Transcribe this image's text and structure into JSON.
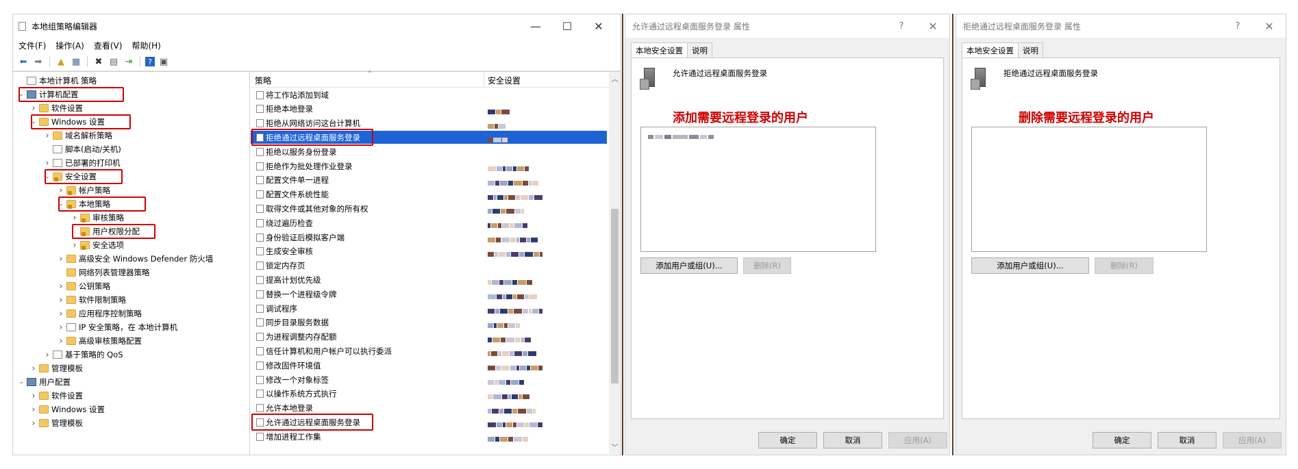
{
  "gpedit": {
    "title": "本地组策略编辑器",
    "menu": [
      "文件(F)",
      "操作(A)",
      "查看(V)",
      "帮助(H)"
    ],
    "tree": [
      {
        "label": "本地计算机 策略",
        "level": 0,
        "arrow": "",
        "icon": "doc"
      },
      {
        "label": "计算机配置",
        "level": 0,
        "arrow": "v",
        "icon": "pc"
      },
      {
        "label": "软件设置",
        "level": 1,
        "arrow": ">",
        "icon": "folder"
      },
      {
        "label": "Windows 设置",
        "level": 1,
        "arrow": "v",
        "icon": "folder"
      },
      {
        "label": "域名解析策略",
        "level": 2,
        "arrow": ">",
        "icon": "folder"
      },
      {
        "label": "脚本(启动/关机)",
        "level": 2,
        "arrow": "",
        "icon": "doc"
      },
      {
        "label": "已部署的打印机",
        "level": 2,
        "arrow": ">",
        "icon": "doc"
      },
      {
        "label": "安全设置",
        "level": 2,
        "arrow": "v",
        "icon": "folder-lock"
      },
      {
        "label": "帐户策略",
        "level": 3,
        "arrow": ">",
        "icon": "folder-lock"
      },
      {
        "label": "本地策略",
        "level": 3,
        "arrow": "v",
        "icon": "folder-lock"
      },
      {
        "label": "审核策略",
        "level": 4,
        "arrow": ">",
        "icon": "folder-lock"
      },
      {
        "label": "用户权限分配",
        "level": 4,
        "arrow": "",
        "icon": "folder-lock"
      },
      {
        "label": "安全选项",
        "level": 4,
        "arrow": ">",
        "icon": "folder-lock"
      },
      {
        "label": "高级安全 Windows Defender 防火墙",
        "level": 3,
        "arrow": ">",
        "icon": "folder"
      },
      {
        "label": "网络列表管理器策略",
        "level": 3,
        "arrow": "",
        "icon": "folder"
      },
      {
        "label": "公钥策略",
        "level": 3,
        "arrow": ">",
        "icon": "folder"
      },
      {
        "label": "软件限制策略",
        "level": 3,
        "arrow": ">",
        "icon": "folder"
      },
      {
        "label": "应用程序控制策略",
        "level": 3,
        "arrow": ">",
        "icon": "folder"
      },
      {
        "label": "IP 安全策略，在 本地计算机",
        "level": 3,
        "arrow": ">",
        "icon": "doc"
      },
      {
        "label": "高级审核策略配置",
        "level": 3,
        "arrow": ">",
        "icon": "folder"
      },
      {
        "label": "基于策略的 QoS",
        "level": 2,
        "arrow": ">",
        "icon": "doc"
      },
      {
        "label": "管理模板",
        "level": 1,
        "arrow": ">",
        "icon": "folder"
      },
      {
        "label": "用户配置",
        "level": 0,
        "arrow": "v",
        "icon": "pc"
      },
      {
        "label": "软件设置",
        "level": 1,
        "arrow": ">",
        "icon": "folder"
      },
      {
        "label": "Windows 设置",
        "level": 1,
        "arrow": ">",
        "icon": "folder"
      },
      {
        "label": "管理模板",
        "level": 1,
        "arrow": ">",
        "icon": "folder"
      }
    ],
    "list_headers": {
      "policy": "策略",
      "setting": "安全设置"
    },
    "policies": [
      "将工作站添加到域",
      "拒绝本地登录",
      "拒绝从网络访问这台计算机",
      "拒绝通过远程桌面服务登录",
      "拒绝以服务身份登录",
      "拒绝作为批处理作业登录",
      "配置文件单一进程",
      "配置文件系统性能",
      "取得文件或其他对象的所有权",
      "绕过遍历检查",
      "身份验证后模拟客户端",
      "生成安全审核",
      "锁定内存页",
      "提高计划优先级",
      "替换一个进程级令牌",
      "调试程序",
      "同步目录服务数据",
      "为进程调整内存配额",
      "信任计算机和用户帐户可以执行委派",
      "修改固件环境值",
      "修改一个对象标签",
      "以操作系统方式执行",
      "允许本地登录",
      "允许通过远程桌面服务登录",
      "增加进程工作集"
    ],
    "selected_policy_index": 3
  },
  "dialog_allow": {
    "title": "允许通过远程桌面服务登录 属性",
    "tabs": [
      "本地安全设置",
      "说明"
    ],
    "policy_name": "允许通过远程桌面服务登录",
    "annotation": "添加需要远程登录的用户",
    "add_button": "添加用户或组(U)...",
    "remove_button": "删除(R)",
    "ok": "确定",
    "cancel": "取消",
    "apply": "应用(A)"
  },
  "dialog_deny": {
    "title": "拒绝通过远程桌面服务登录 属性",
    "tabs": [
      "本地安全设置",
      "说明"
    ],
    "policy_name": "拒绝通过远程桌面服务登录",
    "annotation": "删除需要远程登录的用户",
    "add_button": "添加用户或组(U)...",
    "remove_button": "删除(R)",
    "ok": "确定",
    "cancel": "取消",
    "apply": "应用(A)"
  },
  "colors": {
    "highlight": "#d00000",
    "selection": "#1e63d6"
  }
}
